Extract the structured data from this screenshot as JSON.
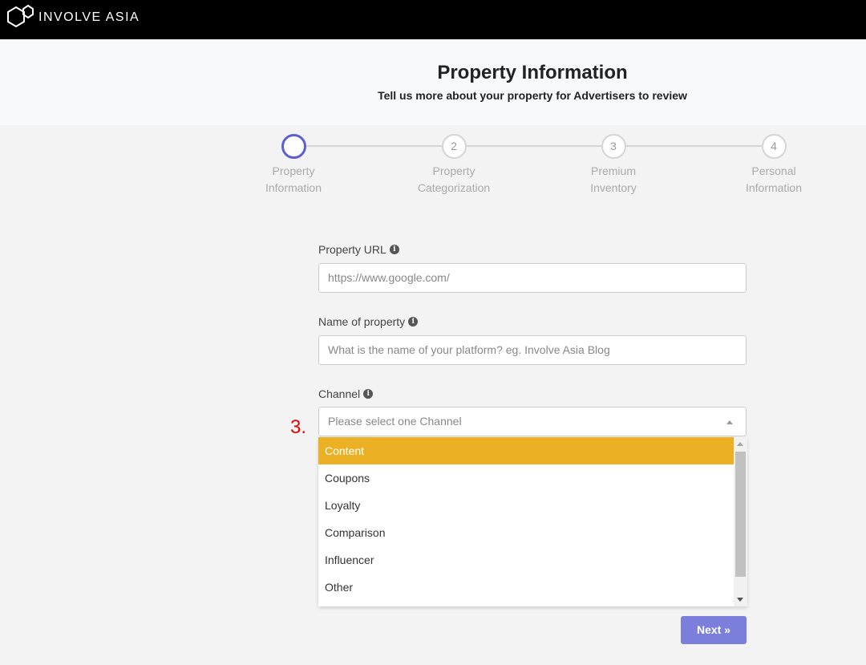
{
  "header": {
    "brand": "INVOLVE ASIA"
  },
  "hero": {
    "title": "Property Information",
    "subtitle": "Tell us more about your property for Advertisers to review"
  },
  "steps": [
    {
      "number": "",
      "label1": "Property",
      "label2": "Information",
      "active": true
    },
    {
      "number": "2",
      "label1": "Property",
      "label2": "Categorization"
    },
    {
      "number": "3",
      "label1": "Premium",
      "label2": "Inventory"
    },
    {
      "number": "4",
      "label1": "Personal",
      "label2": "Information"
    }
  ],
  "form": {
    "url": {
      "label": "Property URL",
      "placeholder": "https://www.google.com/"
    },
    "name": {
      "label": "Name of property",
      "placeholder": "What is the name of your platform? eg. Involve Asia Blog"
    },
    "channel": {
      "label": "Channel",
      "placeholder": "Please select one Channel",
      "options": [
        "Content",
        "Coupons",
        "Loyalty",
        "Comparison",
        "Influencer",
        "Other"
      ],
      "highlighted": "Content"
    }
  },
  "annotation": "3.",
  "next_label": "Next »",
  "colors": {
    "accent": "#5c5fd0",
    "button": "#7b7fdb",
    "highlight": "#ecb025",
    "annotation": "#ee0000"
  }
}
